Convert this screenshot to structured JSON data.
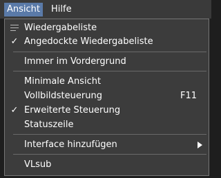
{
  "menubar": {
    "items": [
      {
        "label": "Ansicht"
      },
      {
        "label": "Hilfe"
      }
    ]
  },
  "menu": {
    "items": [
      {
        "label": "Wiedergabeliste",
        "icon": "playlist-icon"
      },
      {
        "label": "Angedockte Wiedergabeliste",
        "checked": true
      },
      {
        "label": "Immer im Vordergrund"
      },
      {
        "label": "Minimale Ansicht"
      },
      {
        "label": "Vollbildsteuerung",
        "shortcut": "F11"
      },
      {
        "label": "Erweiterte Steuerung",
        "checked": true
      },
      {
        "label": "Statuszeile"
      },
      {
        "label": "Interface hinzufügen",
        "submenu": true
      },
      {
        "label": "VLsub"
      }
    ],
    "check_glyph": "✓"
  },
  "colors": {
    "menubar_bg": "#3a3a3a",
    "active_menu_bg": "#5a7aa8",
    "menu_bg": "#3c3c3c",
    "text": "#ffffff"
  }
}
